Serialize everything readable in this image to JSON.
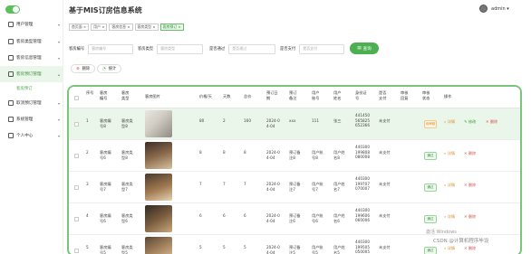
{
  "header": {
    "title": "基于MIS订房信息系统",
    "user": "admin ▾"
  },
  "sidebar": {
    "items": [
      {
        "label": "用户管理",
        "chevron": "▾"
      },
      {
        "label": "客房类型管理",
        "chevron": "▾"
      },
      {
        "label": "客房信息管理",
        "chevron": "▾"
      },
      {
        "label": "客房预订管理",
        "chevron": "▴"
      },
      {
        "label": "取消预订管理",
        "chevron": "▾"
      },
      {
        "label": "系统管理",
        "chevron": "▾"
      },
      {
        "label": "个人中心",
        "chevron": "▾"
      }
    ],
    "sub_item": "客房预订"
  },
  "tabs": [
    "首页面 ×",
    "用户 ×",
    "客房信息 ×",
    "客房类型 ×",
    "客房预订 ×"
  ],
  "filters": {
    "room_no_label": "客房编号",
    "room_no_placeholder": "客房编号",
    "room_type_label": "客房类型",
    "room_type_placeholder": "客房类型",
    "audit_label": "是否通过",
    "audit_placeholder": "是否通过",
    "paid_label": "是否支付",
    "paid_placeholder": "是否支付",
    "search": "查询"
  },
  "actions": {
    "delete": "删除",
    "stats": "统计"
  },
  "table": {
    "headers": [
      "序号",
      "客房编号",
      "客房类型",
      "客房图片",
      "价格/天",
      "天数",
      "总价",
      "预订日期",
      "预订备注",
      "用户账号",
      "用户姓名",
      "身份证号",
      "是否支付",
      "审核回复",
      "审核状态",
      "操作"
    ],
    "rows": [
      {
        "idx": "1",
        "room_no": "客房编号8",
        "room_type": "客房类型8",
        "price": "80",
        "days": "2",
        "total": "160",
        "date": "2024-04-04",
        "note": "xxx",
        "account": "111",
        "name": "张三",
        "id_card": "441450565825652366",
        "paid": "未支付",
        "reply": "",
        "status": "待审核",
        "pending": true
      },
      {
        "idx": "2",
        "room_no": "客房编号6",
        "room_type": "客房类型8",
        "price": "8",
        "days": "8",
        "total": "8",
        "date": "2024-04-04",
        "note": "预订备注8",
        "account": "用户账号8",
        "name": "用户姓名8",
        "id_card": "440300199808080008",
        "paid": "未支付",
        "reply": "",
        "status": "通过",
        "pending": false
      },
      {
        "idx": "3",
        "room_no": "客房编号7",
        "room_type": "客房类型7",
        "price": "7",
        "days": "7",
        "total": "7",
        "date": "2024-04-04",
        "note": "预订备注7",
        "account": "用户账号7",
        "name": "用户姓名7",
        "id_card": "440300199707070007",
        "paid": "未支付",
        "reply": "",
        "status": "通过",
        "pending": false
      },
      {
        "idx": "4",
        "room_no": "客房编号6",
        "room_type": "客房类型6",
        "price": "6",
        "days": "6",
        "total": "6",
        "date": "2024-04-04",
        "note": "预订备注6",
        "account": "用户账号6",
        "name": "用户姓名6",
        "id_card": "440300199606060006",
        "paid": "未支付",
        "reply": "",
        "status": "通过",
        "pending": false
      },
      {
        "idx": "5",
        "room_no": "客房编号5",
        "room_type": "客房类型5",
        "price": "5",
        "days": "5",
        "total": "5",
        "date": "2024-04-04",
        "note": "预订备注5",
        "account": "用户账号5",
        "name": "用户姓名5",
        "id_card": "440300199505050005",
        "paid": "未支付",
        "reply": "",
        "status": "通过",
        "pending": false
      }
    ],
    "ops": {
      "view": "详情",
      "edit": "修改",
      "remove": "删除"
    }
  },
  "overlay": {
    "activate": "激活 Windows",
    "csdn": "CSDN @计算机程序毕设"
  },
  "colors": {
    "accent": "#4caf50",
    "border": "#7bc47b",
    "danger": "#d9534f",
    "warning": "#d9902c"
  }
}
